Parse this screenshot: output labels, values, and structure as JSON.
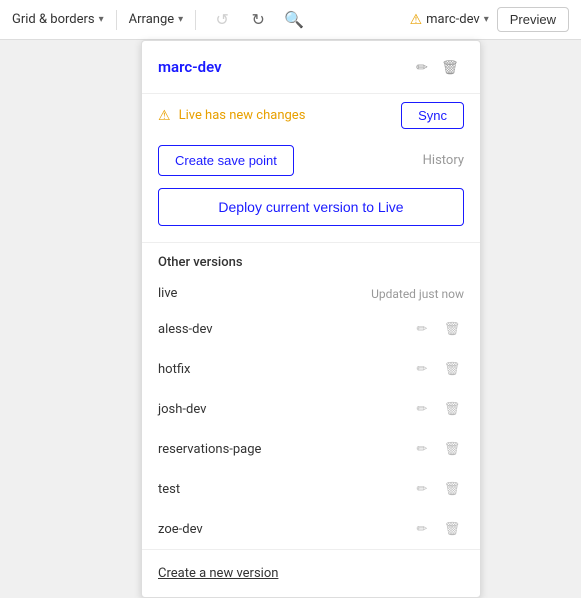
{
  "toolbar": {
    "grid_borders_label": "Grid & borders",
    "arrange_label": "Arrange",
    "undo_label": "Undo",
    "redo_label": "Redo",
    "search_label": "Search",
    "warning_label": "marc-dev",
    "preview_label": "Preview"
  },
  "panel": {
    "title": "marc-dev",
    "alert_text": "Live has new changes",
    "sync_button_label": "Sync",
    "save_point_button_label": "Create save point",
    "history_link_label": "History",
    "deploy_button_label": "Deploy current version to Live",
    "other_versions_header": "Other versions",
    "create_version_link": "Create a new version",
    "versions": [
      {
        "name": "live",
        "badge": "Updated just now",
        "has_badge": true
      },
      {
        "name": "aless-dev",
        "badge": "",
        "has_badge": false
      },
      {
        "name": "hotfix",
        "badge": "",
        "has_badge": false
      },
      {
        "name": "josh-dev",
        "badge": "",
        "has_badge": false
      },
      {
        "name": "reservations-page",
        "badge": "",
        "has_badge": false
      },
      {
        "name": "test",
        "badge": "",
        "has_badge": false
      },
      {
        "name": "zoe-dev",
        "badge": "",
        "has_badge": false
      }
    ]
  }
}
